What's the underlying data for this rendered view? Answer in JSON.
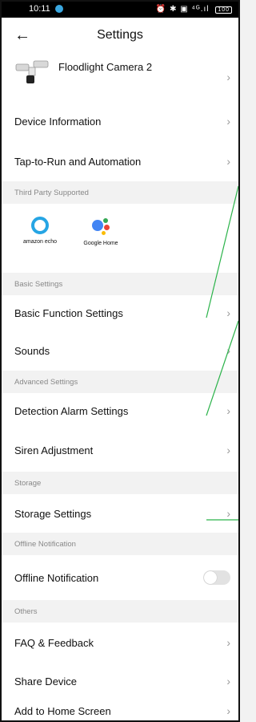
{
  "status_bar": {
    "time": "10:11",
    "right_icons": "⏰ ✱ ▣ ⁴ᴳ.ıl",
    "battery": "100"
  },
  "header": {
    "title": "Settings"
  },
  "device": {
    "name": "Floodlight Camera  2"
  },
  "rows": {
    "device_info": "Device Information",
    "tap_to_run": "Tap-to-Run and Automation",
    "basic_function": "Basic Function Settings",
    "sounds": "Sounds",
    "detection_alarm": "Detection Alarm Settings",
    "siren": "Siren Adjustment",
    "storage_settings": "Storage Settings",
    "offline_notification": "Offline Notification",
    "faq": "FAQ & Feedback",
    "share": "Share Device",
    "add_home": "Add to Home Screen"
  },
  "sections": {
    "third_party": "Third Party Supported",
    "basic": "Basic Settings",
    "advanced": "Advanced Settings",
    "storage": "Storage",
    "offline": "Offline Notification",
    "others": "Others"
  },
  "third_party": {
    "alexa": "amazon echo",
    "google": "Google Home"
  },
  "colors": {
    "annotation": "#2bb34a",
    "alexa_ring": "#26a5e4"
  },
  "toggles": {
    "offline_notification": false
  }
}
